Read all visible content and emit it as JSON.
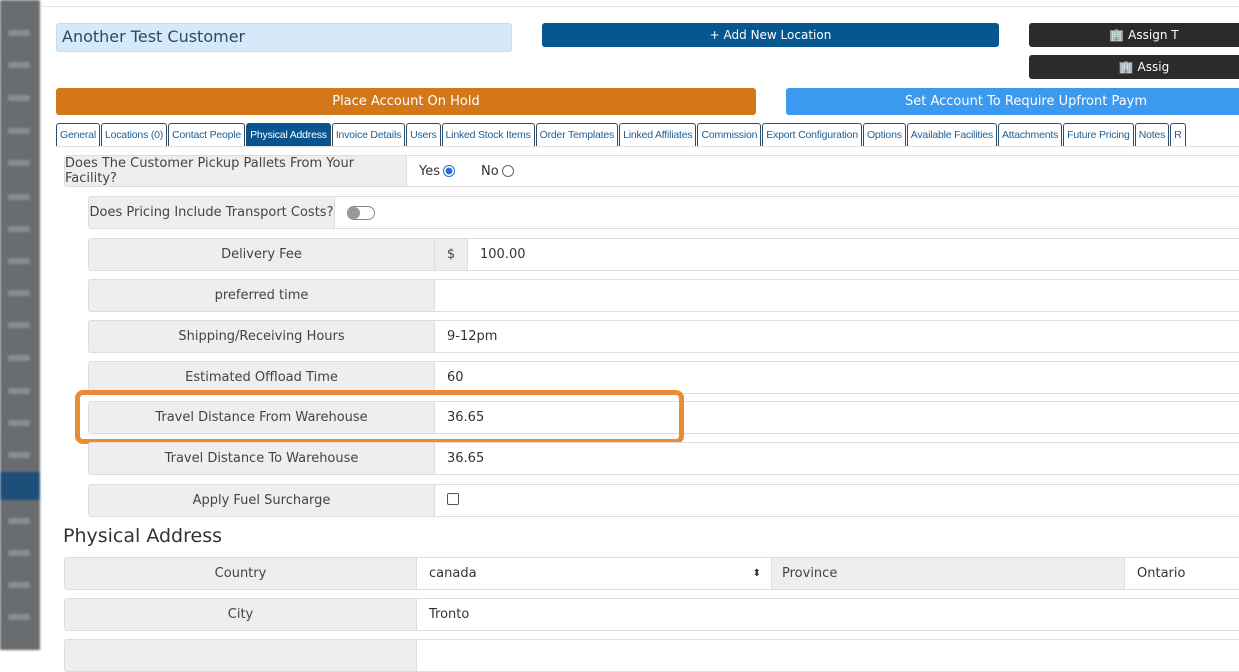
{
  "customer_name": "Another Test Customer",
  "buttons": {
    "add_location": "+ Add New Location",
    "assign_1": "🏢 Assign T",
    "assign_2": "🏢 Assig",
    "hold": "Place Account On Hold",
    "upfront": "Set Account To Require Upfront Paym"
  },
  "tabs": [
    "General",
    "Locations (0)",
    "Contact People",
    "Physical Address",
    "Invoice Details",
    "Users",
    "Linked Stock Items",
    "Order Templates",
    "Linked Affiliates",
    "Commission",
    "Export Configuration",
    "Options",
    "Available Facilities",
    "Attachments",
    "Future Pricing",
    "Notes",
    "R"
  ],
  "pickup": {
    "label": "Does The Customer Pickup Pallets From Your Facility?",
    "yes": "Yes",
    "no": "No",
    "selected": "Yes"
  },
  "transport": {
    "label": "Does Pricing Include Transport Costs?",
    "enabled": false
  },
  "delivery_fee": {
    "label": "Delivery Fee",
    "currency": "$",
    "value": "100.00"
  },
  "preferred_time": {
    "label": "preferred time",
    "value": ""
  },
  "hours": {
    "label": "Shipping/Receiving Hours",
    "value": "9-12pm"
  },
  "offload": {
    "label": "Estimated Offload Time",
    "value": "60"
  },
  "dist_from": {
    "label": "Travel Distance From Warehouse",
    "value": "36.65"
  },
  "dist_to": {
    "label": "Travel Distance To Warehouse",
    "value": "36.65"
  },
  "fuel": {
    "label": "Apply Fuel Surcharge",
    "checked": false
  },
  "address": {
    "title": "Physical Address",
    "country_label": "Country",
    "country": "canada",
    "province_label": "Province",
    "province": "Ontario",
    "city_label": "City",
    "city": "Tronto"
  }
}
